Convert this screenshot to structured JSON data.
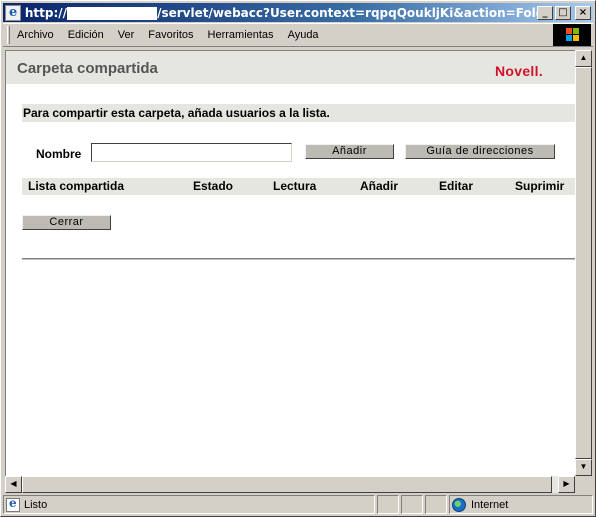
{
  "window": {
    "title_prefix": "http://",
    "title_suffix": "/servlet/webacc?User.context=rqpqQoukljKi&action=Folder.ListSh...",
    "buttons": {
      "minimize": "_",
      "maximize": "□",
      "close": "×"
    }
  },
  "menu": {
    "items": [
      "Archivo",
      "Edición",
      "Ver",
      "Favoritos",
      "Herramientas",
      "Ayuda"
    ]
  },
  "page": {
    "title": "Carpeta compartida",
    "brand": "Novell.",
    "instruction": "Para compartir esta carpeta, añada usuarios a la lista.",
    "name_label": "Nombre",
    "name_value": "",
    "add_button": "Añadir",
    "directory_button": "Guía de direcciones",
    "table_headers": [
      "Lista compartida",
      "Estado",
      "Lectura",
      "Añadir",
      "Editar",
      "Suprimir"
    ],
    "close_button": "Cerrar"
  },
  "status": {
    "text": "Listo",
    "zone": "Internet"
  },
  "colors": {
    "brand": "#d2112c",
    "title_bar": "#0a246a",
    "band": "#e6e6e0"
  }
}
